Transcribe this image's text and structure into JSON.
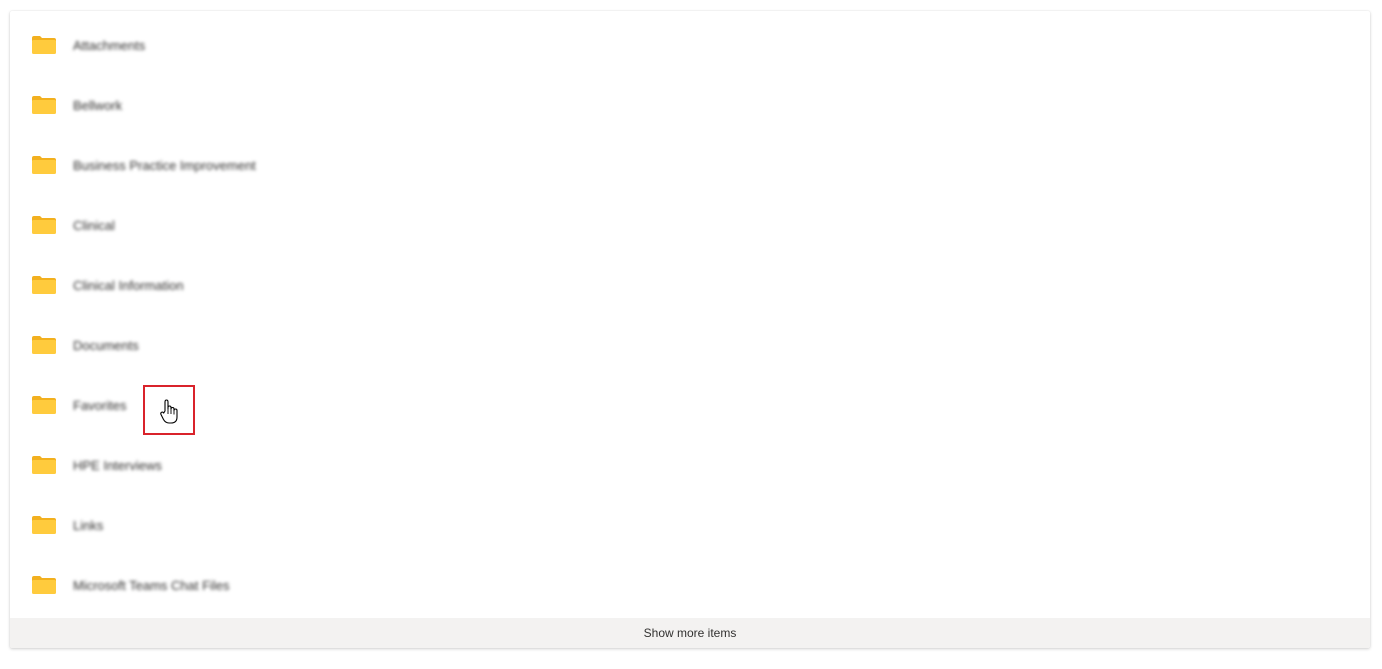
{
  "folders": [
    {
      "name": "Attachments"
    },
    {
      "name": "Bellwork"
    },
    {
      "name": "Business Practice Improvement"
    },
    {
      "name": "Clinical"
    },
    {
      "name": "Clinical Information"
    },
    {
      "name": "Documents"
    },
    {
      "name": "Favorites"
    },
    {
      "name": "HPE Interviews"
    },
    {
      "name": "Links"
    },
    {
      "name": "Microsoft Teams Chat Files"
    }
  ],
  "show_more_label": "Show more items",
  "icons": {
    "folder": "folder-icon",
    "cursor": "hand-pointer-icon"
  },
  "colors": {
    "folder_fill": "#FFCB3D",
    "folder_tab": "#F2B01E",
    "highlight_border": "#D9232B",
    "footer_bg": "#F3F2F1"
  }
}
